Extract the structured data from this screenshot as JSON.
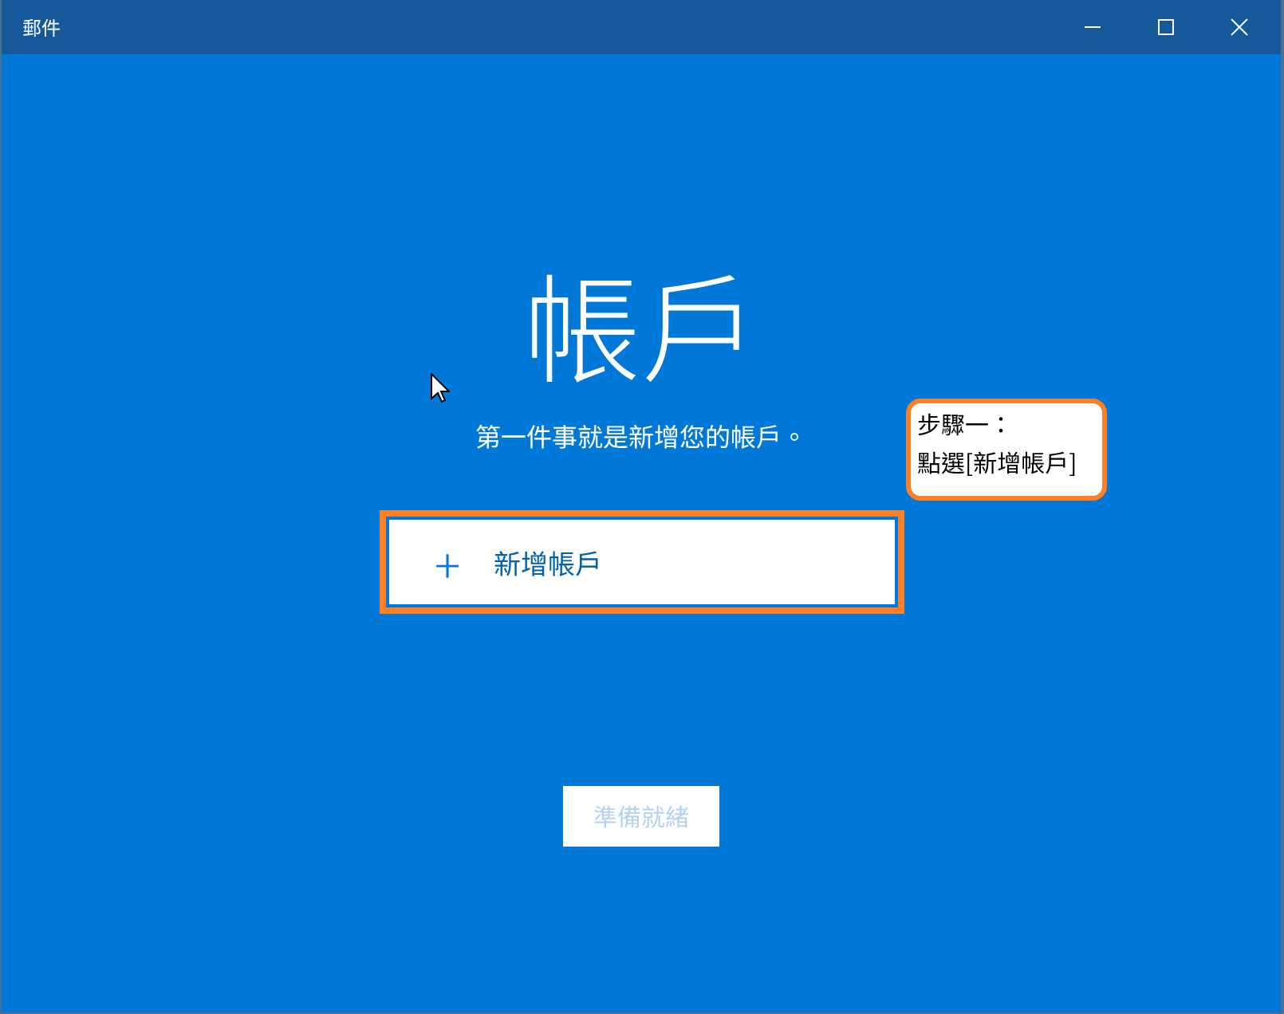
{
  "window": {
    "title": "郵件"
  },
  "heading": "帳戶",
  "subtitle": "第一件事就是新增您的帳戶。",
  "add_account_button": {
    "icon": "+",
    "label": "新增帳戶",
    "highlighted": true
  },
  "annotation": {
    "lines": [
      "步驟一：",
      "點選[新增帳戶]"
    ]
  },
  "ready_button": {
    "label": "準備就緒",
    "disabled": true
  }
}
